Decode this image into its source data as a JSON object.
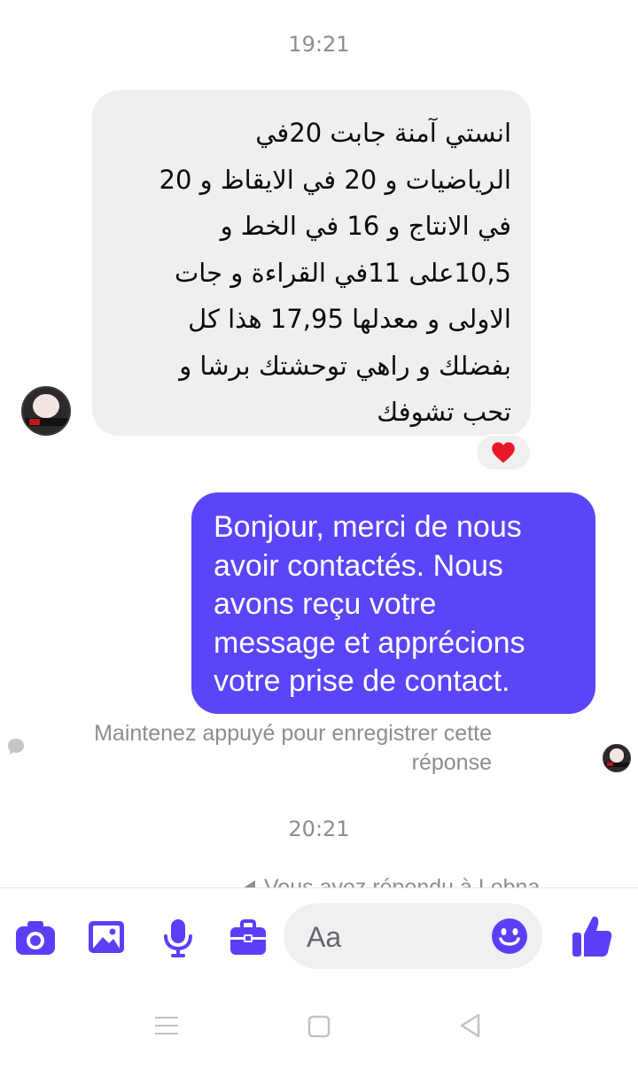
{
  "timestamps": {
    "first": "19:21",
    "second": "20:21"
  },
  "incoming_message": {
    "lines": [
      "انستي آمنة جابت 20في",
      "الرياضيات و 20 في الايقاظ و 20",
      "في الانتاج و 16 في الخط و",
      "10,5على 11في القراءة و جات",
      "الاولى و معدلها 17,95 هذا كل",
      "بفضلك و راهي توحشتك برشا و",
      "تحب تشوفك"
    ],
    "reaction": "❤️"
  },
  "outgoing_message": {
    "lines": [
      "Bonjour, merci de nous",
      "avoir contactés. Nous",
      "avons reçu votre",
      "message et apprécions",
      "votre prise de contact."
    ]
  },
  "save_hint": {
    "line1": "Maintenez appuyé pour enregistrer cette",
    "line2": "réponse"
  },
  "partial_notice": "Vous avez répondu à Lobna",
  "composer": {
    "placeholder": "Aa"
  },
  "icons": {
    "camera": "camera-icon",
    "gallery": "image-icon",
    "microphone": "microphone-icon",
    "toolbox": "toolbox-icon",
    "emoji": "emoji-icon",
    "like": "thumbs-up-icon",
    "chat_bubble": "chat-bubble-icon",
    "nav_menu": "menu-icon",
    "nav_home": "home-square-icon",
    "nav_back": "back-triangle-icon"
  },
  "colors": {
    "accent": "#5b45f8",
    "incoming_bubble": "#efeff0",
    "muted_text": "#8a8d91",
    "icon_blue": "#5b3ff6"
  }
}
